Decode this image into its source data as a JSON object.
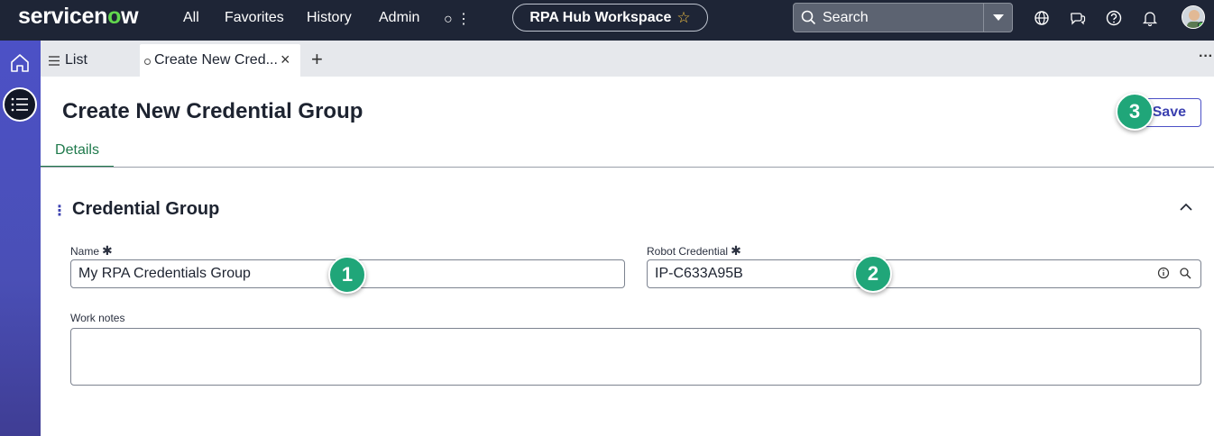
{
  "topbar": {
    "logo_prefix": "servicen",
    "logo_accent": "o",
    "logo_suffix": "w",
    "nav": [
      "All",
      "Favorites",
      "History",
      "Admin"
    ],
    "nav_more": "○ ⋮",
    "workspace": "RPA Hub Workspace",
    "search_placeholder": "Search",
    "icons": [
      "globe-icon",
      "chat-icon",
      "help-icon",
      "bell-icon"
    ]
  },
  "tabs": {
    "list_label": "List",
    "active_label": "Create New Cred...",
    "close": "×",
    "add": "+",
    "more": "···"
  },
  "page": {
    "title": "Create New Credential Group",
    "save_label": "Save",
    "details_tab": "Details"
  },
  "section": {
    "title": "Credential Group",
    "kebab": "⋮"
  },
  "form": {
    "name_label": "Name",
    "name_value": "My RPA Credentials Group",
    "robot_label": "Robot Credential",
    "robot_value": "IP-C633A95B",
    "work_notes_label": "Work notes",
    "work_notes_value": "",
    "required_mark": "✱"
  },
  "callouts": [
    "1",
    "2",
    "3"
  ],
  "colors": {
    "topbar": "#1e2536",
    "rail": "#4c51c6",
    "accent_green": "#1f7a4c",
    "callout": "#20a679",
    "save_border": "#4c51c6"
  }
}
